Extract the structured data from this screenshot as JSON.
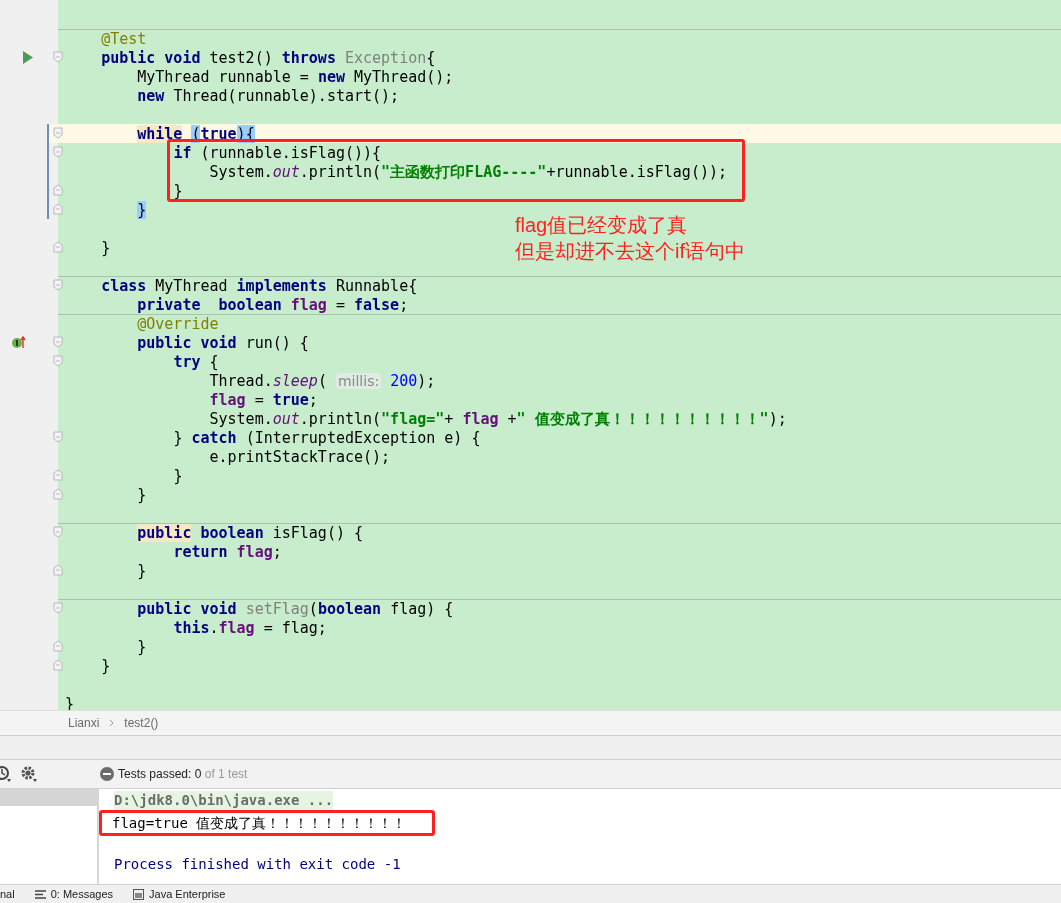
{
  "editor": {
    "lines": [
      {
        "caret": false,
        "changed": false,
        "divider": false
      },
      {
        "caret": false,
        "changed": false,
        "divider": true,
        "tokens": [
          {
            "text": "    @Test",
            "kind": "annotation"
          }
        ]
      },
      {
        "caret": false,
        "changed": false,
        "divider": false,
        "tokens": [
          {
            "text": "    public void ",
            "kind": "kw"
          },
          {
            "text": "test2() ",
            "kind": "plain"
          },
          {
            "text": "throws ",
            "kind": "kw"
          },
          {
            "text": "Exception",
            "kind": "unused"
          },
          {
            "text": "{",
            "kind": "plain"
          }
        ]
      },
      {
        "caret": false,
        "changed": false,
        "divider": false,
        "tokens": [
          {
            "text": "        MyThread runnable = ",
            "kind": "plain"
          },
          {
            "text": "new ",
            "kind": "kw"
          },
          {
            "text": "MyThread();",
            "kind": "plain"
          }
        ]
      },
      {
        "caret": false,
        "changed": false,
        "divider": false,
        "tokens": [
          {
            "text": "        new ",
            "kind": "kw"
          },
          {
            "text": "Thread(runnable).start();",
            "kind": "plain"
          }
        ]
      },
      {
        "caret": false,
        "changed": false,
        "divider": false
      },
      {
        "caret": true,
        "changed": true,
        "divider": false,
        "tokens": [
          {
            "text": "        while",
            "kind": "kw",
            "usage": true
          },
          {
            "text": " (",
            "kind": "plain",
            "matched": true
          },
          {
            "text": "true",
            "kind": "kw"
          },
          {
            "text": ")",
            "kind": "plain",
            "matched": true
          },
          {
            "text": "{",
            "kind": "plain",
            "matched": true
          }
        ]
      },
      {
        "caret": false,
        "changed": true,
        "divider": false,
        "tokens": [
          {
            "text": "            if ",
            "kind": "kw"
          },
          {
            "text": "(runnable.isFlag()){",
            "kind": "plain"
          }
        ]
      },
      {
        "caret": false,
        "changed": true,
        "divider": false,
        "tokens": [
          {
            "text": "                System.",
            "kind": "plain"
          },
          {
            "text": "out",
            "kind": "static"
          },
          {
            "text": ".println(",
            "kind": "plain"
          },
          {
            "text": "\"主函数打印FLAG----\"",
            "kind": "str"
          },
          {
            "text": "+runnable.isFlag());",
            "kind": "plain"
          }
        ]
      },
      {
        "caret": false,
        "changed": true,
        "divider": false,
        "tokens": [
          {
            "text": "            }",
            "kind": "plain"
          }
        ]
      },
      {
        "caret": false,
        "changed": true,
        "divider": false,
        "tokens": [
          {
            "text": "        }",
            "kind": "plain",
            "matched": true
          }
        ]
      },
      {
        "caret": false,
        "changed": false,
        "divider": false
      },
      {
        "caret": false,
        "changed": false,
        "divider": false,
        "tokens": [
          {
            "text": "    }",
            "kind": "plain"
          }
        ]
      },
      {
        "caret": false,
        "changed": false,
        "divider": false
      },
      {
        "caret": false,
        "changed": false,
        "divider": true,
        "tokens": [
          {
            "text": "    class ",
            "kind": "kw"
          },
          {
            "text": "MyThread ",
            "kind": "plain"
          },
          {
            "text": "implements ",
            "kind": "kw"
          },
          {
            "text": "Runnable{",
            "kind": "plain"
          }
        ]
      },
      {
        "caret": false,
        "changed": false,
        "divider": false,
        "tokens": [
          {
            "text": "        private  boolean ",
            "kind": "kw"
          },
          {
            "text": "flag",
            "kind": "field"
          },
          {
            "text": " = ",
            "kind": "plain"
          },
          {
            "text": "false",
            "kind": "kw"
          },
          {
            "text": ";",
            "kind": "plain"
          }
        ]
      },
      {
        "caret": false,
        "changed": false,
        "divider": true,
        "tokens": [
          {
            "text": "        @Override",
            "kind": "annotation"
          }
        ]
      },
      {
        "caret": false,
        "changed": false,
        "divider": false,
        "tokens": [
          {
            "text": "        public void ",
            "kind": "kw"
          },
          {
            "text": "run() {",
            "kind": "plain"
          }
        ]
      },
      {
        "caret": false,
        "changed": false,
        "divider": false,
        "tokens": [
          {
            "text": "            try ",
            "kind": "kw"
          },
          {
            "text": "{",
            "kind": "plain"
          }
        ]
      },
      {
        "caret": false,
        "changed": false,
        "divider": false,
        "tokens": [
          {
            "text": "                Thread.",
            "kind": "plain"
          },
          {
            "text": "sleep",
            "kind": "static"
          },
          {
            "text": "( ",
            "kind": "plain"
          },
          {
            "text": "millis:",
            "kind": "hint"
          },
          {
            "text": " 200",
            "kind": "num"
          },
          {
            "text": ");",
            "kind": "plain"
          }
        ]
      },
      {
        "caret": false,
        "changed": false,
        "divider": false,
        "tokens": [
          {
            "text": "                flag",
            "kind": "field"
          },
          {
            "text": " = ",
            "kind": "plain"
          },
          {
            "text": "true",
            "kind": "kw"
          },
          {
            "text": ";",
            "kind": "plain"
          }
        ]
      },
      {
        "caret": false,
        "changed": false,
        "divider": false,
        "tokens": [
          {
            "text": "                System.",
            "kind": "plain"
          },
          {
            "text": "out",
            "kind": "static"
          },
          {
            "text": ".println(",
            "kind": "plain"
          },
          {
            "text": "\"flag=\"",
            "kind": "str"
          },
          {
            "text": "+ ",
            "kind": "plain"
          },
          {
            "text": "flag",
            "kind": "field"
          },
          {
            "text": " +",
            "kind": "plain"
          },
          {
            "text": "\" 值变成了真！！！！！！！！！！\"",
            "kind": "str"
          },
          {
            "text": ");",
            "kind": "plain"
          }
        ]
      },
      {
        "caret": false,
        "changed": false,
        "divider": false,
        "tokens": [
          {
            "text": "            } ",
            "kind": "plain"
          },
          {
            "text": "catch ",
            "kind": "kw"
          },
          {
            "text": "(InterruptedException e) {",
            "kind": "plain"
          }
        ]
      },
      {
        "caret": false,
        "changed": false,
        "divider": false,
        "tokens": [
          {
            "text": "                e.printStackTrace();",
            "kind": "plain"
          }
        ]
      },
      {
        "caret": false,
        "changed": false,
        "divider": false,
        "tokens": [
          {
            "text": "            }",
            "kind": "plain"
          }
        ]
      },
      {
        "caret": false,
        "changed": false,
        "divider": false,
        "tokens": [
          {
            "text": "        }",
            "kind": "plain"
          }
        ]
      },
      {
        "caret": false,
        "changed": false,
        "divider": false
      },
      {
        "caret": false,
        "changed": false,
        "divider": true,
        "tokens": [
          {
            "text": "        public",
            "kind": "kw",
            "usage": true
          },
          {
            "text": " boolean ",
            "kind": "kw"
          },
          {
            "text": "isFlag() {",
            "kind": "plain"
          }
        ]
      },
      {
        "caret": false,
        "changed": false,
        "divider": false,
        "tokens": [
          {
            "text": "            return ",
            "kind": "kw"
          },
          {
            "text": "flag",
            "kind": "field"
          },
          {
            "text": ";",
            "kind": "plain"
          }
        ]
      },
      {
        "caret": false,
        "changed": false,
        "divider": false,
        "tokens": [
          {
            "text": "        }",
            "kind": "plain"
          }
        ]
      },
      {
        "caret": false,
        "changed": false,
        "divider": false
      },
      {
        "caret": false,
        "changed": false,
        "divider": true,
        "tokens": [
          {
            "text": "        public void ",
            "kind": "kw"
          },
          {
            "text": "setFlag",
            "kind": "unused"
          },
          {
            "text": "(",
            "kind": "plain"
          },
          {
            "text": "boolean ",
            "kind": "kw"
          },
          {
            "text": "flag) {",
            "kind": "plain"
          }
        ]
      },
      {
        "caret": false,
        "changed": false,
        "divider": false,
        "tokens": [
          {
            "text": "            this",
            "kind": "kw"
          },
          {
            "text": ".",
            "kind": "plain"
          },
          {
            "text": "flag",
            "kind": "field"
          },
          {
            "text": " = flag;",
            "kind": "plain"
          }
        ]
      },
      {
        "caret": false,
        "changed": false,
        "divider": false,
        "tokens": [
          {
            "text": "        }",
            "kind": "plain"
          }
        ]
      },
      {
        "caret": false,
        "changed": false,
        "divider": false,
        "tokens": [
          {
            "text": "    }",
            "kind": "plain"
          }
        ]
      },
      {
        "caret": false,
        "changed": false,
        "divider": false
      },
      {
        "caret": false,
        "changed": false,
        "divider": false,
        "tokens": [
          {
            "text": "}",
            "kind": "plain"
          }
        ]
      }
    ],
    "note": [
      "flag值已经变成了真",
      "但是却进不去这个if语句中"
    ]
  },
  "breadcrumb": [
    "Lianxi",
    "test2()"
  ],
  "test_status": {
    "label": "Tests passed:",
    "passed": "0",
    "total": "of 1 test"
  },
  "console": {
    "lines": [
      {
        "kind": "command",
        "text": "D:\\jdk8.0\\bin\\java.exe ..."
      },
      {
        "kind": "output",
        "text": "flag=true 值变成了真！！！！！！！！！！",
        "boxed": true
      },
      {
        "kind": "blank"
      },
      {
        "kind": "system",
        "text": "Process finished with exit code -1"
      }
    ]
  },
  "bottom_tabs": [
    "nal",
    "0: Messages",
    "Java Enterprise"
  ]
}
